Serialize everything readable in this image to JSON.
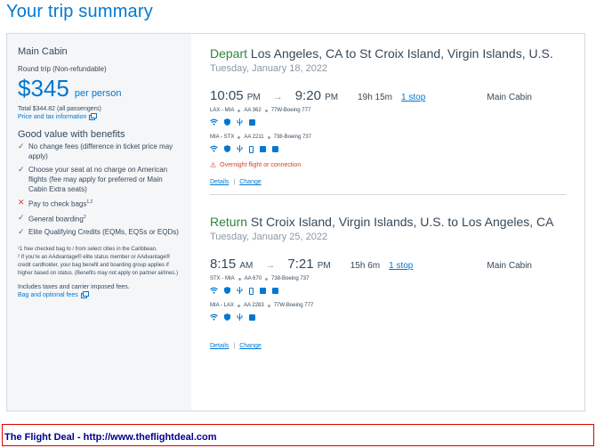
{
  "page": {
    "title": "Your trip summary"
  },
  "summary": {
    "cabin": "Main Cabin",
    "trip_type": "Round trip (Non-refundable)",
    "price_currency": "$",
    "price_amount": "345",
    "price_unit": "per person",
    "total": "Total $344.82 (all passengers)",
    "price_link": "Price and tax information",
    "benefits_title": "Good value with benefits",
    "benefits": [
      {
        "mark": "✓",
        "text": "No change fees (difference in ticket price may apply)",
        "sup": ""
      },
      {
        "mark": "✓",
        "text": "Choose your seat at no charge on American flights (fee may apply for preferred or Main Cabin Extra seats)",
        "sup": ""
      },
      {
        "mark": "✕",
        "text": "Pay to check bags",
        "sup": "1,2"
      },
      {
        "mark": "✓",
        "text": "General boarding",
        "sup": "2"
      },
      {
        "mark": "✓",
        "text": "Elite Qualifying Credits (EQMs, EQSs or EQDs)",
        "sup": ""
      }
    ],
    "note1": "¹1 free checked bag to / from select cities in the Caribbean.",
    "note2": "² If you're an AAdvantage® elite status member or AAdvantage® credit cardholder, your bag benefit and boarding group applies if higher based on status. (Benefits may not apply on partner airlines.)",
    "taxes": "Includes taxes and carrier imposed fees.",
    "bag_link": "Bag and optional fees"
  },
  "depart": {
    "label": "Depart",
    "route": "Los Angeles, CA to St Croix Island, Virgin Islands, U.S.",
    "date": "Tuesday, January 18, 2022",
    "dep_time": "10:05",
    "dep_ampm": "PM",
    "arr_time": "9:20",
    "arr_ampm": "PM",
    "arrow": "→",
    "duration": "19h 15m",
    "stops": "1 stop",
    "cabin": "Main Cabin",
    "legs": [
      {
        "route": "LAX - MIA",
        "flight": "AA 362",
        "aircraft": "77W-Boeing 777"
      },
      {
        "route": "MIA - STX",
        "flight": "AA 2211",
        "aircraft": "738-Boeing 737"
      }
    ],
    "warning": "Overnight flight or connection",
    "details": "Details",
    "change": "Change"
  },
  "return": {
    "label": "Return",
    "route": "St Croix Island, Virgin Islands, U.S. to Los Angeles, CA",
    "date": "Tuesday, January 25, 2022",
    "dep_time": "8:15",
    "dep_ampm": "AM",
    "arr_time": "7:21",
    "arr_ampm": "PM",
    "arrow": "→",
    "duration": "15h 6m",
    "stops": "1 stop",
    "cabin": "Main Cabin",
    "legs": [
      {
        "route": "STX - MIA",
        "flight": "AA 670",
        "aircraft": "738-Boeing 737"
      },
      {
        "route": "MIA - LAX",
        "flight": "AA 2283",
        "aircraft": "77W-Boeing 777"
      }
    ],
    "details": "Details",
    "change": "Change"
  },
  "ad": {
    "text": "The Flight Deal - http://www.theflightdeal.com"
  },
  "colors": {
    "brand_blue": "#0078d2",
    "green": "#2e8540",
    "warning": "#d14424"
  }
}
